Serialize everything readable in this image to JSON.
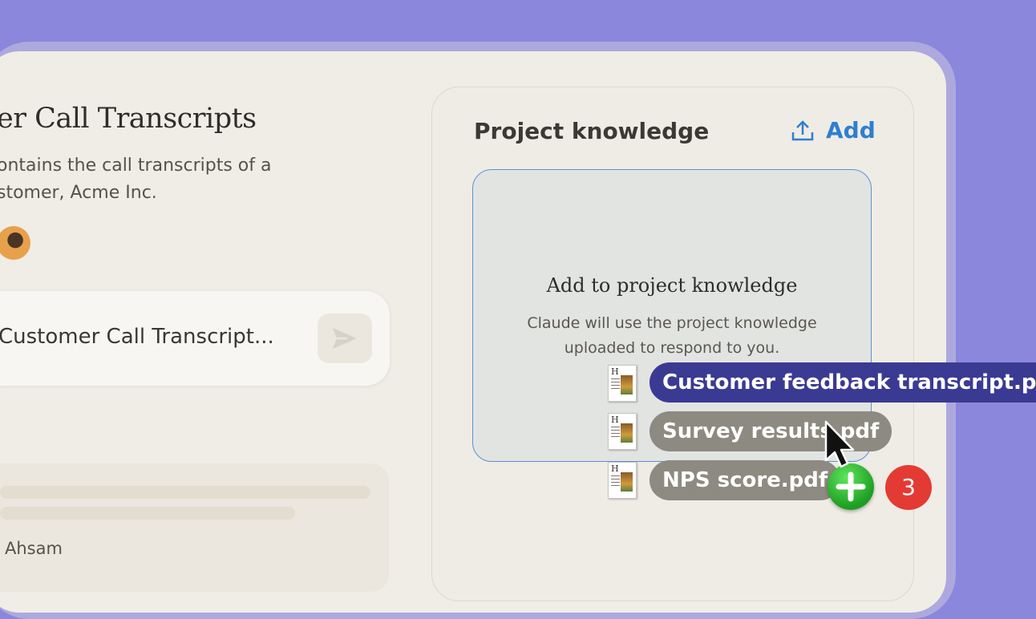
{
  "project": {
    "title": "er Call Transcripts",
    "description_line1": "ontains the call transcripts of a",
    "description_line2": "stomer, Acme Inc."
  },
  "chat": {
    "input_text": "Customer Call Transcript..."
  },
  "recent_card": {
    "author": "Ahsam"
  },
  "knowledge": {
    "title": "Project knowledge",
    "add_label": "Add",
    "dropzone_title": "Add to project knowledge",
    "dropzone_desc_line1": "Claude will use the project knowledge",
    "dropzone_desc_line2": "uploaded to respond to you."
  },
  "dragged_files": [
    {
      "name": "Customer feedback transcript.pdf"
    },
    {
      "name": "Survey results.pdf"
    },
    {
      "name": "NPS score.pdf"
    }
  ],
  "drag_badge": {
    "count": "3"
  },
  "colors": {
    "background": "#8b87dc",
    "accent": "#2f7fd0",
    "dropzone_border": "#5b91d3",
    "primary_pill": "#3b3a93",
    "secondary_pill": "#8d8a82",
    "plus_badge": "#2aac2c",
    "count_badge": "#e43a34"
  },
  "icons": {
    "send": "send-icon",
    "upload": "upload-icon",
    "file": "pdf-file-icon",
    "plus": "plus-icon",
    "cursor": "cursor-arrow-icon"
  }
}
